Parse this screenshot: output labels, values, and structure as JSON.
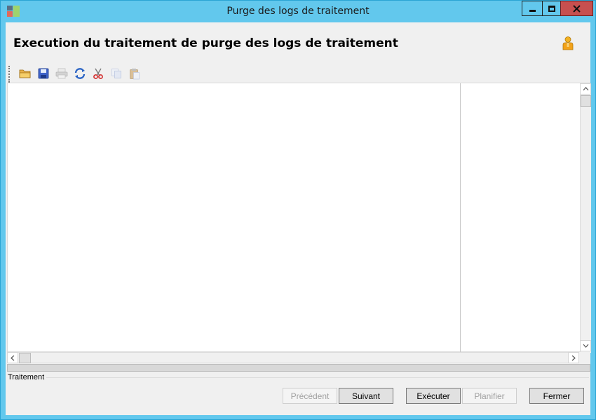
{
  "window": {
    "title": "Purge des logs de traitement"
  },
  "header": {
    "title": "Execution du traitement de purge des logs de traitement"
  },
  "toolbar": {
    "buttons": [
      {
        "icon": "open-folder-icon",
        "enabled": true
      },
      {
        "icon": "save-disk-icon",
        "enabled": true
      },
      {
        "icon": "print-icon",
        "enabled": false
      },
      {
        "icon": "refresh-icon",
        "enabled": true
      },
      {
        "icon": "cut-scissors-icon",
        "enabled": true
      },
      {
        "icon": "copy-icon",
        "enabled": false
      },
      {
        "icon": "paste-icon",
        "enabled": false
      }
    ]
  },
  "progress": {
    "value_percent": 0
  },
  "group": {
    "label": "Traitement"
  },
  "buttons": {
    "previous": "Précédent",
    "next": "Suivant",
    "execute": "Exécuter",
    "schedule": "Planifier",
    "close": "Fermer"
  },
  "colors": {
    "titlebar": "#62c8ed",
    "close_button": "#c7504f",
    "client_bg": "#f0f0f0"
  }
}
